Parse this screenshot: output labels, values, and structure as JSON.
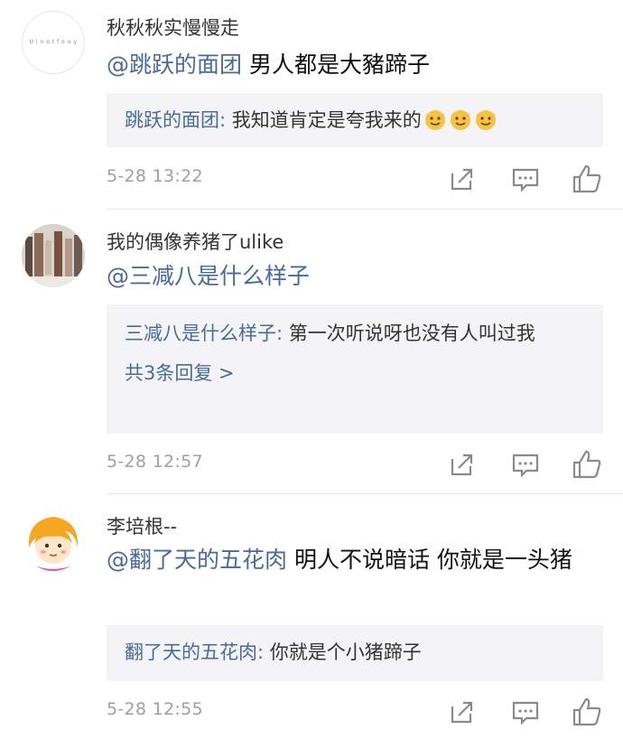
{
  "comments": [
    {
      "username": "秋秋秋实慢慢走",
      "avatar_text": "U i n o t f o u y",
      "mention": "@跳跃的面团",
      "text": " 男人都是大豬蹄子",
      "quote": {
        "name": "跳跃的面团:",
        "text": " 我知道肯定是夸我来的",
        "emoji": [
          "cat-face-emoji",
          "cat-face-emoji",
          "cat-face-emoji"
        ]
      },
      "time": "5-28 13:22"
    },
    {
      "username": "我的偶像养猪了ulike",
      "mention": "@三减八是什么样子",
      "text": "",
      "quote": {
        "name": "三减八是什么样子:",
        "text": " 第一次听说呀也没有人叫过我",
        "more": "共3条回复 >"
      },
      "time": "5-28 12:57"
    },
    {
      "username": "李培根--",
      "mention": "@翻了天的五花肉",
      "text": " 明人不说暗话 你就是一头猪",
      "quote": {
        "name": "翻了天的五花肉:",
        "text": " 你就是个小猪蹄子"
      },
      "time": "5-28 12:55"
    }
  ],
  "icons": {
    "share": "share-icon",
    "comment": "comment-icon",
    "like": "thumbs-up-icon"
  },
  "colors": {
    "mention": "#4a6a99",
    "quote_background": "#f4f4f6",
    "timestamp": "#a0a0a0",
    "icon": "#8a8a8a"
  }
}
